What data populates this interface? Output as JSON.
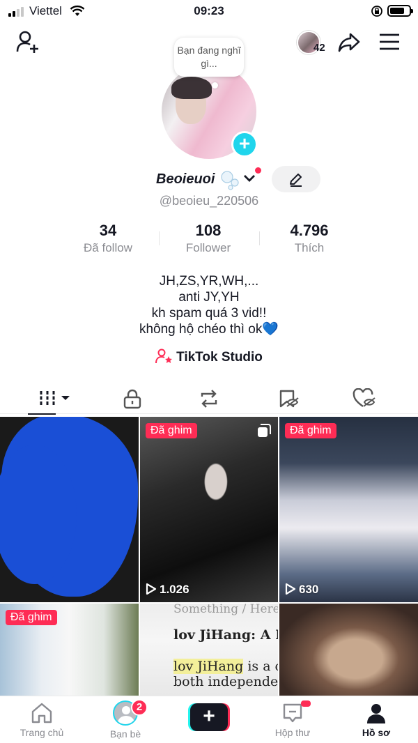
{
  "status_bar": {
    "carrier": "Viettel",
    "time": "09:23"
  },
  "header": {
    "viewer_count": "42"
  },
  "profile": {
    "thought_bubble": "Bạn đang nghĩ gì...",
    "display_name": "Beoieuoi",
    "username": "@beoieu_220506"
  },
  "stats": [
    {
      "value": "34",
      "label": "Đã follow"
    },
    {
      "value": "108",
      "label": "Follower"
    },
    {
      "value": "4.796",
      "label": "Thích"
    }
  ],
  "bio": {
    "lines": [
      "JH,ZS,YR,WH,...",
      "anti JY,YH",
      "kh spam quá 3 vid!!",
      "không hộ chéo thì ok"
    ],
    "emoji": "💙"
  },
  "studio_link": "TikTok Studio",
  "videos": [
    {
      "pinned": false,
      "plays": ""
    },
    {
      "pinned": true,
      "pin_label": "Đã ghim",
      "plays": "1.026"
    },
    {
      "pinned": true,
      "pin_label": "Đã ghim",
      "plays": "630"
    },
    {
      "pinned": true,
      "pin_label": "Đã ghim",
      "plays": ""
    },
    {
      "pinned": false,
      "text_lines": [
        "Something / Here",
        "lov JiHang: A F",
        "lov JiHang is a c",
        "both independer"
      ]
    },
    {
      "pinned": false,
      "plays": ""
    }
  ],
  "bottom_nav": {
    "home": "Trang chủ",
    "friends": "Bạn bè",
    "friends_badge": "2",
    "inbox": "Hộp thư",
    "profile": "Hồ sơ"
  },
  "colors": {
    "accent": "#fe2c55",
    "cyan": "#20d5ec",
    "text": "#161823",
    "muted": "#8a8b91"
  }
}
